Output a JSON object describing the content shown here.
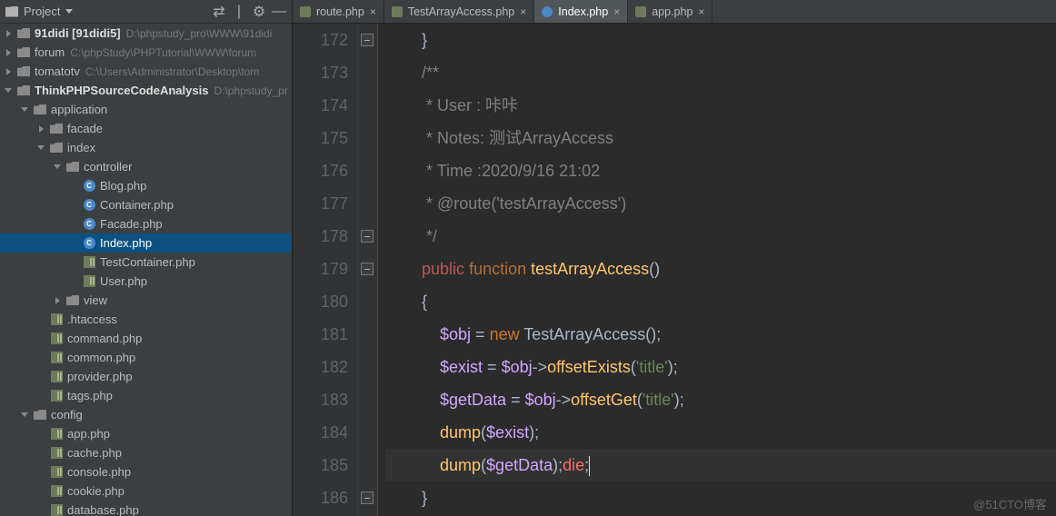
{
  "panel": {
    "title": "Project"
  },
  "projects": [
    {
      "name": "91didi [91didi5]",
      "hint": "D:\\phpstudy_pro\\WWW\\91didi",
      "bold": true
    },
    {
      "name": "forum",
      "hint": "C:\\phpStudy\\PHPTutorial\\WWW\\forum"
    },
    {
      "name": "tomatotv",
      "hint": "C:\\Users\\Administrator\\Desktop\\tom"
    },
    {
      "name": "ThinkPHPSourceCodeAnalysis",
      "hint": "D:\\phpstudy_pr",
      "bold": true,
      "open": true
    }
  ],
  "app_tree": {
    "application": "application",
    "facade": "facade",
    "index": "index",
    "controller": "controller",
    "ctrl_files": [
      "Blog.php",
      "Container.php",
      "Facade.php",
      "Index.php",
      "TestContainer.php",
      "User.php"
    ],
    "view": "view",
    "app_files": [
      ".htaccess",
      "command.php",
      "common.php",
      "provider.php",
      "tags.php"
    ],
    "config": "config",
    "cfg_files": [
      "app.php",
      "cache.php",
      "console.php",
      "cookie.php",
      "database.php"
    ]
  },
  "selected_file": "Index.php",
  "tabs": [
    {
      "label": "route.php",
      "icon": "cfg"
    },
    {
      "label": "TestArrayAccess.php",
      "icon": "cfg"
    },
    {
      "label": "Index.php",
      "icon": "php",
      "active": true
    },
    {
      "label": "app.php",
      "icon": "cfg"
    }
  ],
  "code": {
    "start": 172,
    "lines": [
      {
        "t": "        }"
      },
      {
        "t": "        /**",
        "cls": "c-cmt"
      },
      {
        "t": "         * User : 咔咔",
        "cls": "c-cmt"
      },
      {
        "t": "         * Notes: 测试ArrayAccess",
        "cls": "c-cmt"
      },
      {
        "t": "         * Time :2020/9/16 21:02",
        "cls": "c-cmt"
      },
      {
        "t": "         * @route('testArrayAccess')",
        "cls": "c-cmt"
      },
      {
        "t": "         */",
        "cls": "c-cmt"
      },
      {
        "html": "        <span class='kw-pub'>public</span> <span class='kw-func'>function</span> <span class='c-fn'>testArrayAccess</span>()"
      },
      {
        "t": "        {"
      },
      {
        "html": "            <span class='c-var'>$obj</span> = <span class='c-key'>new</span> TestArrayAccess();"
      },
      {
        "html": "            <span class='c-var'>$exist</span> = <span class='c-var'>$obj</span>-><span class='c-fn'>offsetExists</span>(<span class='c-str'>'title'</span>);"
      },
      {
        "html": "            <span class='c-var'>$getData</span> = <span class='c-var'>$obj</span>-><span class='c-fn'>offsetGet</span>(<span class='c-str'>'title'</span>);"
      },
      {
        "html": "            <span class='c-fn'>dump</span>(<span class='c-var'>$exist</span>);"
      },
      {
        "html": "            <span class='c-fn'>dump</span>(<span class='c-var'>$getData</span>);<span class='c-die'>die</span>;<span class='caret'></span>",
        "hl": true
      },
      {
        "t": "        }"
      }
    ],
    "fold_marks": [
      0,
      6,
      7,
      14
    ]
  },
  "watermark": "@51CTO博客"
}
